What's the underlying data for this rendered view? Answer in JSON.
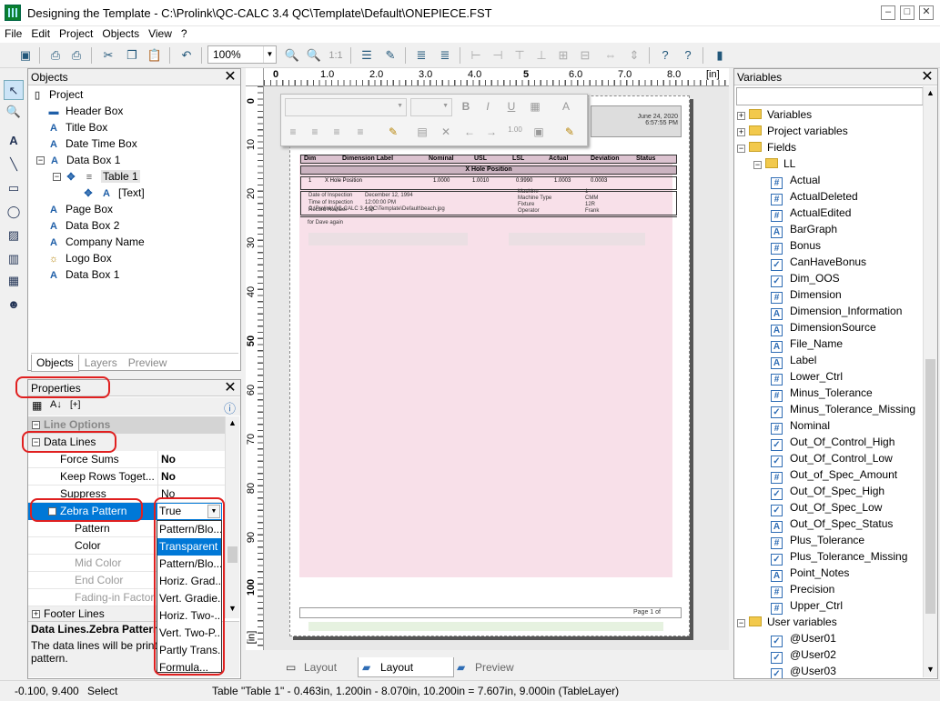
{
  "window": {
    "title": "Designing the Template - C:\\Prolink\\QC-CALC 3.4 QC\\Template\\Default\\ONEPIECE.FST"
  },
  "menu": [
    "File",
    "Edit",
    "Project",
    "Objects",
    "View",
    "?"
  ],
  "toolbar": {
    "zoom": "100%",
    "zoom_ratio": "1:1"
  },
  "objects_panel": {
    "title": "Objects",
    "tree": [
      {
        "label": "Project",
        "icon": "page"
      },
      {
        "label": "Header Box",
        "icon": "line"
      },
      {
        "label": "Title Box",
        "icon": "A"
      },
      {
        "label": "Date Time Box",
        "icon": "A"
      },
      {
        "label": "Data Box 1",
        "icon": "A"
      },
      {
        "label": "Table 1",
        "icon": "table"
      },
      {
        "label": "[Text]",
        "icon": "A"
      },
      {
        "label": "Page Box",
        "icon": "A"
      },
      {
        "label": "Data Box 2",
        "icon": "A"
      },
      {
        "label": "Company Name",
        "icon": "A"
      },
      {
        "label": "Logo Box",
        "icon": "image"
      },
      {
        "label": "Data Box 1",
        "icon": "A"
      }
    ],
    "tabs": [
      "Objects",
      "Layers",
      "Preview"
    ]
  },
  "properties_panel": {
    "title": "Properties",
    "sort_label": "[+]",
    "section_line_options": "Line Options",
    "section_data_lines": "Data Lines",
    "rows": [
      {
        "key": "Force Sums",
        "value": "No"
      },
      {
        "key": "Keep Rows Toget...",
        "value": "No"
      },
      {
        "key": "Suppress",
        "value": "No"
      }
    ],
    "zebra": {
      "key": "Zebra Pattern",
      "value": "True"
    },
    "sub_rows": [
      "Pattern",
      "Color",
      "Mid Color",
      "End Color",
      "Fading-in Factor"
    ],
    "footer_lines": "Footer Lines",
    "desc_title": "Data Lines.Zebra Pattern",
    "desc_text": "The data lines will be print",
    "desc_text2": "pattern.",
    "dropdown": [
      "Pattern/Blo...",
      "Transparent",
      "Pattern/Blo...",
      "Horiz. Grad...",
      "Vert. Gradie...",
      "Horiz. Two-...",
      "Vert. Two-P...",
      "Partly Trans...",
      "Formula..."
    ],
    "dropdown_selected": 1
  },
  "rulers": {
    "h": [
      "0",
      "1.0",
      "2.0",
      "3.0",
      "4.0",
      "5",
      "6.0",
      "7.0",
      "8.0",
      "[in]"
    ],
    "v": [
      "0",
      "10",
      "20",
      "30",
      "40",
      "50",
      "60",
      "70",
      "80",
      "90",
      "100",
      "[in]"
    ]
  },
  "preview": {
    "date": "June 24, 2020",
    "time": "6:57:55 PM",
    "headers": [
      "Dim",
      "Dimension Label",
      "Nominal",
      "USL",
      "LSL",
      "Actual",
      "Deviation",
      "Status"
    ],
    "sub_header": "X Hole Position",
    "row1": [
      "1",
      "X Hole Position",
      "1.0000",
      "1.0010",
      "0.9990",
      "1.0003",
      "0.0003"
    ],
    "info_left": [
      "Date of Inspection",
      "Time of Inspection",
      "Record Number"
    ],
    "info_left_vals": [
      "December 12, 1994",
      "12:00:00 PM",
      "100"
    ],
    "info_right": [
      "Machine",
      "Machine Type",
      "Fixture",
      "Operator"
    ],
    "info_right_vals": [
      "1",
      "CMM",
      "12R",
      "Frank"
    ],
    "path": "C:\\Prolink\\QC-CALC 3.4 QC\\Template\\Default\\beach.jpg",
    "note": "for Dave again",
    "page_label": "Page 1 of"
  },
  "bottom_tabs": [
    "Layout",
    "Layout Preview",
    "Preview"
  ],
  "variables_panel": {
    "title": "Variables",
    "groups": [
      "Variables",
      "Project variables",
      "Fields"
    ],
    "ll": "LL",
    "fields": [
      {
        "name": "Actual",
        "icon": "#"
      },
      {
        "name": "ActualDeleted",
        "icon": "#"
      },
      {
        "name": "ActualEdited",
        "icon": "#"
      },
      {
        "name": "BarGraph",
        "icon": "A"
      },
      {
        "name": "Bonus",
        "icon": "#"
      },
      {
        "name": "CanHaveBonus",
        "icon": "check"
      },
      {
        "name": "Dim_OOS",
        "icon": "check"
      },
      {
        "name": "Dimension",
        "icon": "#"
      },
      {
        "name": "Dimension_Information",
        "icon": "A"
      },
      {
        "name": "DimensionSource",
        "icon": "A"
      },
      {
        "name": "File_Name",
        "icon": "A"
      },
      {
        "name": "Label",
        "icon": "A"
      },
      {
        "name": "Lower_Ctrl",
        "icon": "#"
      },
      {
        "name": "Minus_Tolerance",
        "icon": "#"
      },
      {
        "name": "Minus_Tolerance_Missing",
        "icon": "check"
      },
      {
        "name": "Nominal",
        "icon": "#"
      },
      {
        "name": "Out_Of_Control_High",
        "icon": "check"
      },
      {
        "name": "Out_Of_Control_Low",
        "icon": "check"
      },
      {
        "name": "Out_of_Spec_Amount",
        "icon": "#"
      },
      {
        "name": "Out_Of_Spec_High",
        "icon": "check"
      },
      {
        "name": "Out_Of_Spec_Low",
        "icon": "check"
      },
      {
        "name": "Out_Of_Spec_Status",
        "icon": "A"
      },
      {
        "name": "Plus_Tolerance",
        "icon": "#"
      },
      {
        "name": "Plus_Tolerance_Missing",
        "icon": "check"
      },
      {
        "name": "Point_Notes",
        "icon": "A"
      },
      {
        "name": "Precision",
        "icon": "#"
      },
      {
        "name": "Upper_Ctrl",
        "icon": "#"
      }
    ],
    "user_group": "User variables",
    "user_vars": [
      "@User01",
      "@User02",
      "@User03"
    ]
  },
  "status": {
    "coords": "-0.100, 9.400",
    "mode": "Select",
    "info": "Table \"Table 1\"  -  0.463in, 1.200in  -  8.070in, 10.200in  =  7.607in, 9.000in (TableLayer)"
  }
}
